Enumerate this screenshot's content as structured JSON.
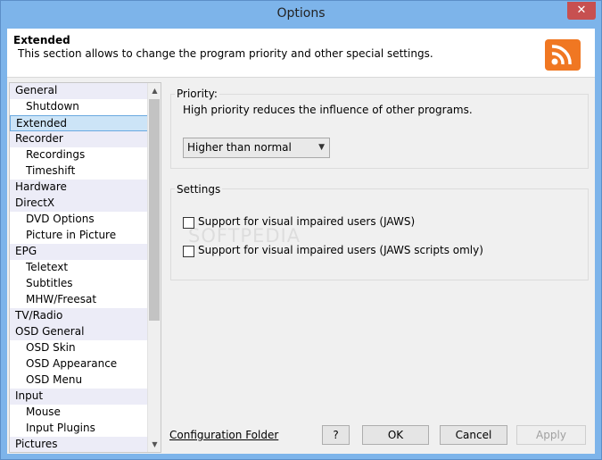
{
  "window": {
    "title": "Options",
    "close_glyph": "✕"
  },
  "header": {
    "title": "Extended",
    "description": "This section allows to change the program priority and other special settings.",
    "logo_icon": "rss-feed-icon"
  },
  "nav": {
    "items": [
      {
        "label": "General",
        "level": "cat"
      },
      {
        "label": "Shutdown",
        "level": "sub"
      },
      {
        "label": "Extended",
        "level": "cat",
        "selected": true
      },
      {
        "label": "Recorder",
        "level": "cat"
      },
      {
        "label": "Recordings",
        "level": "sub"
      },
      {
        "label": "Timeshift",
        "level": "sub"
      },
      {
        "label": "Hardware",
        "level": "cat"
      },
      {
        "label": "DirectX",
        "level": "cat"
      },
      {
        "label": "DVD Options",
        "level": "sub"
      },
      {
        "label": "Picture in Picture",
        "level": "sub"
      },
      {
        "label": "EPG",
        "level": "cat"
      },
      {
        "label": "Teletext",
        "level": "sub"
      },
      {
        "label": "Subtitles",
        "level": "sub"
      },
      {
        "label": "MHW/Freesat",
        "level": "sub"
      },
      {
        "label": "TV/Radio",
        "level": "cat"
      },
      {
        "label": "OSD General",
        "level": "cat"
      },
      {
        "label": "OSD Skin",
        "level": "sub"
      },
      {
        "label": "OSD Appearance",
        "level": "sub"
      },
      {
        "label": "OSD Menu",
        "level": "sub"
      },
      {
        "label": "Input",
        "level": "cat"
      },
      {
        "label": "Mouse",
        "level": "sub"
      },
      {
        "label": "Input Plugins",
        "level": "sub"
      },
      {
        "label": "Pictures",
        "level": "cat"
      }
    ]
  },
  "priority": {
    "group_label": "Priority:",
    "description": "High priority reduces the influence of other programs.",
    "selected": "Higher than normal"
  },
  "settings": {
    "group_label": "Settings",
    "jaws_label": "Support for visual impaired users (JAWS)",
    "jaws_checked": false,
    "jaws_scripts_label": "Support for visual impaired users (JAWS scripts omly)",
    "jaws_scripts_checked": false
  },
  "watermark": "SOFTPEDIA",
  "footer": {
    "config_link": "Configuration Folder",
    "help_label": "?",
    "ok_label": "OK",
    "cancel_label": "Cancel",
    "apply_label": "Apply"
  },
  "colors": {
    "title_bar": "#7db4ea",
    "close_button": "#c75050",
    "logo": "#f07722",
    "nav_category_bg": "#ececf7",
    "nav_selected_bg": "#cce4f7"
  }
}
